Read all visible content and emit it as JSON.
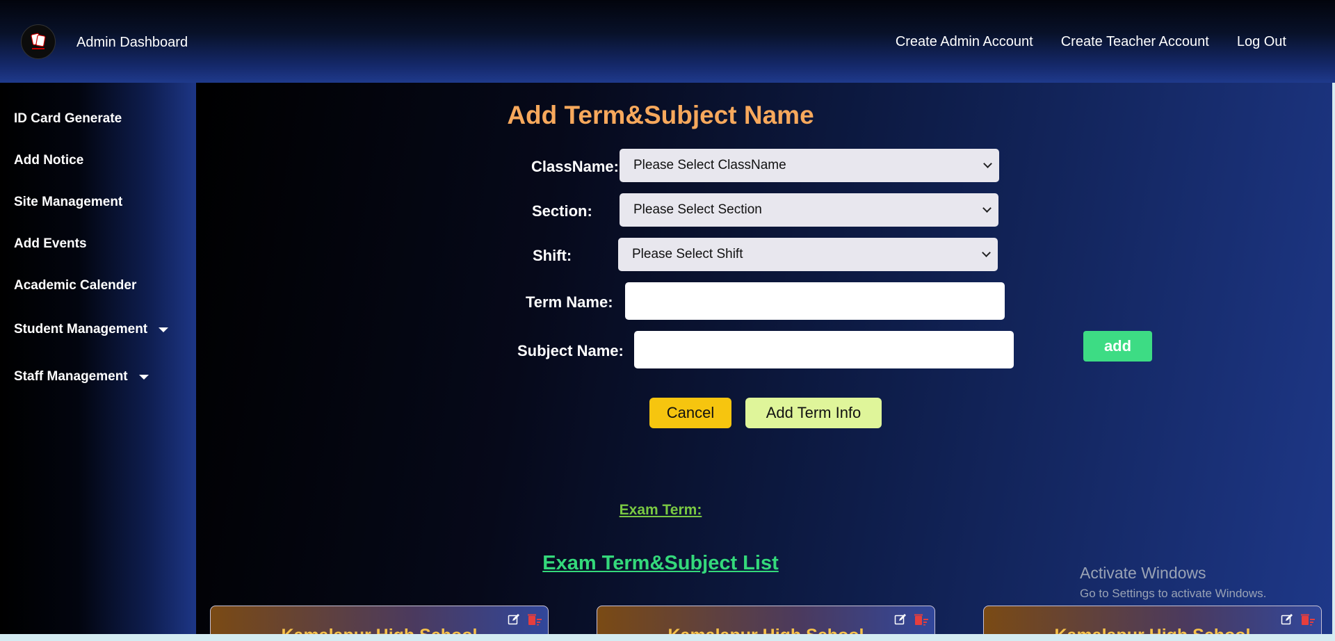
{
  "header": {
    "brand": "Admin Dashboard",
    "nav": [
      "Create Admin Account",
      "Create Teacher Account",
      "Log Out"
    ]
  },
  "sidebar": {
    "items": [
      {
        "label": "ID Card Generate"
      },
      {
        "label": "Add Notice"
      },
      {
        "label": "Site Management"
      },
      {
        "label": "Add Events"
      },
      {
        "label": "Academic Calender"
      },
      {
        "label": "Student Management"
      },
      {
        "label": "Staff Management"
      }
    ]
  },
  "form": {
    "title": "Add Term&Subject Name",
    "classname_label": "ClassName:",
    "classname_value": "Please Select ClassName",
    "section_label": "Section:",
    "section_value": "Please Select Section",
    "shift_label": "Shift:",
    "shift_value": "Please Select Shift",
    "term_label": "Term Name:",
    "subject_label": "Subject Name:",
    "add_label": "add",
    "cancel_label": "Cancel",
    "submit_label": "Add Term Info"
  },
  "list": {
    "exam_term_label": "Exam Term:",
    "title": "Exam Term&Subject List",
    "cards": [
      {
        "title": "Kamalapur High School"
      },
      {
        "title": "Kamalapur High School"
      },
      {
        "title": "Kamalapur High School"
      }
    ]
  },
  "watermark": {
    "line1": "Activate Windows",
    "line2": "Go to Settings to activate Windows."
  },
  "colors": {
    "title_orange": "#f7a85c",
    "add_green": "#3ddc84",
    "cancel_yellow": "#f6c50f",
    "submit_lime": "#dff59a",
    "list_green": "#34d97b",
    "delete_red": "#e53e3e"
  }
}
